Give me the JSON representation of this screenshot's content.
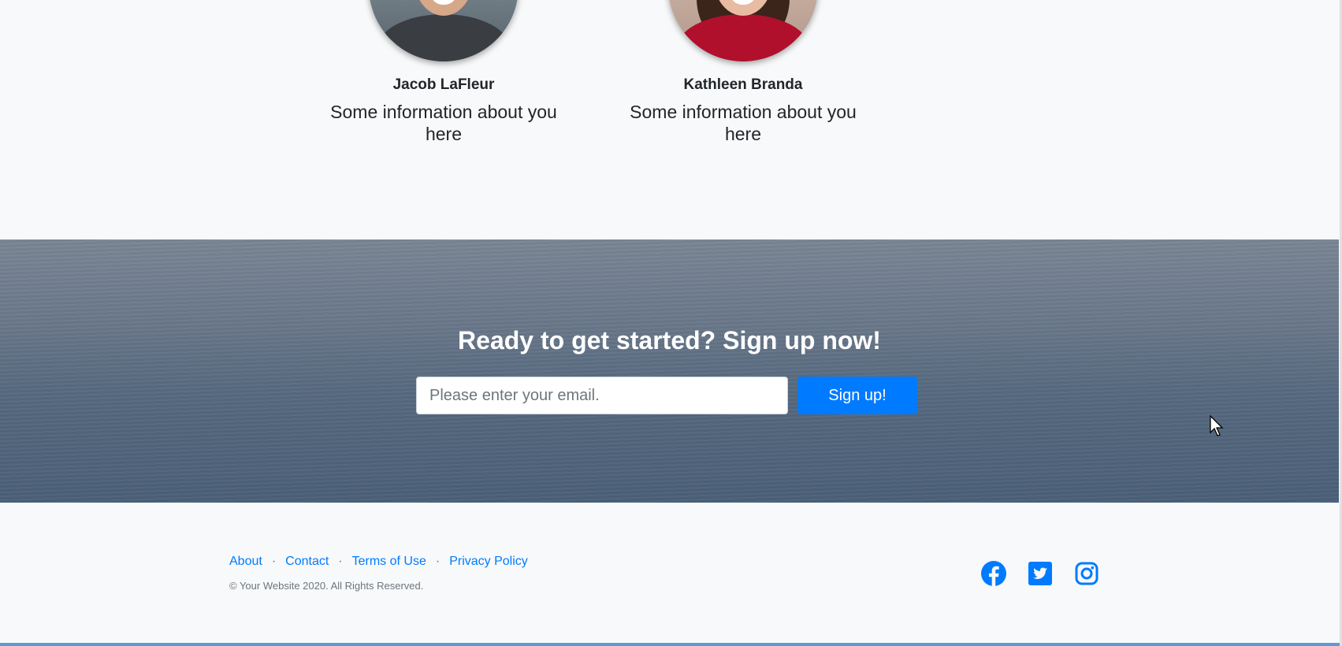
{
  "testimonials": {
    "people": [
      {
        "name": "Jacob LaFleur",
        "info": "Some information about you here"
      },
      {
        "name": "Kathleen Branda",
        "info": "Some information about you here"
      }
    ]
  },
  "cta": {
    "title": "Ready to get started? Sign up now!",
    "email_placeholder": "Please enter your email.",
    "email_value": "",
    "signup_label": "Sign up!"
  },
  "footer": {
    "links": [
      {
        "label": "About"
      },
      {
        "label": "Contact"
      },
      {
        "label": "Terms of Use"
      },
      {
        "label": "Privacy Policy"
      }
    ],
    "separator": "·",
    "copyright": "© Your Website 2020. All Rights Reserved.",
    "social": [
      {
        "icon": "facebook-icon"
      },
      {
        "icon": "twitter-icon"
      },
      {
        "icon": "instagram-icon"
      }
    ]
  },
  "colors": {
    "accent": "#007bff",
    "page_background": "#f8f9fa",
    "text": "#212529",
    "muted": "#6c757d"
  }
}
